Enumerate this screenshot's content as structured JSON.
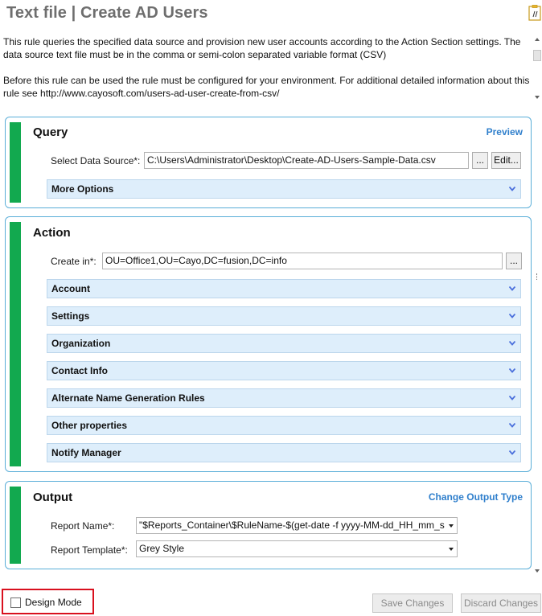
{
  "window": {
    "title": "Text file | Create AD Users"
  },
  "description": {
    "paragraph1": "This rule queries the specified data source and provision new user accounts according to the Action Section settings.  The data source text file must be in the comma or semi-colon separated variable format (CSV)",
    "paragraph2": "Before this rule can be used the rule must be configured for your environment. For additional detailed information about this rule see http://www.cayosoft.com/users-ad-user-create-from-csv/"
  },
  "query": {
    "title": "Query",
    "preview_link": "Preview",
    "data_source_label": "Select Data Source*:",
    "data_source_value": "C:\\Users\\Administrator\\Desktop\\Create-AD-Users-Sample-Data.csv",
    "browse_label": "...",
    "edit_label": "Edit...",
    "more_options_label": "More Options"
  },
  "action": {
    "title": "Action",
    "create_in_label": "Create in*:",
    "create_in_value": "OU=Office1,OU=Cayo,DC=fusion,DC=info",
    "browse_label": "...",
    "expanders": [
      "Account",
      "Settings",
      "Organization",
      "Contact Info",
      "Alternate Name Generation Rules",
      "Other properties",
      "Notify Manager"
    ]
  },
  "output": {
    "title": "Output",
    "change_output_link": "Change Output Type",
    "report_name_label": "Report Name*:",
    "report_name_value": "\"$Reports_Container\\$RuleName-$(get-date -f yyyy-MM-dd_HH_mm_s",
    "report_template_label": "Report Template*:",
    "report_template_value": "Grey Style"
  },
  "footer": {
    "design_mode_label": "Design Mode",
    "design_mode_checked": false,
    "save_label": "Save Changes",
    "discard_label": "Discard Changes"
  },
  "colors": {
    "accent_green": "#12a94f",
    "section_border": "#5aaed8",
    "link_blue": "#2f7fcc",
    "expander_bg": "#deeefb",
    "highlight_red": "#d9101e"
  },
  "icons": {
    "document": "document-icon",
    "chevron": "chevron-down-icon"
  }
}
